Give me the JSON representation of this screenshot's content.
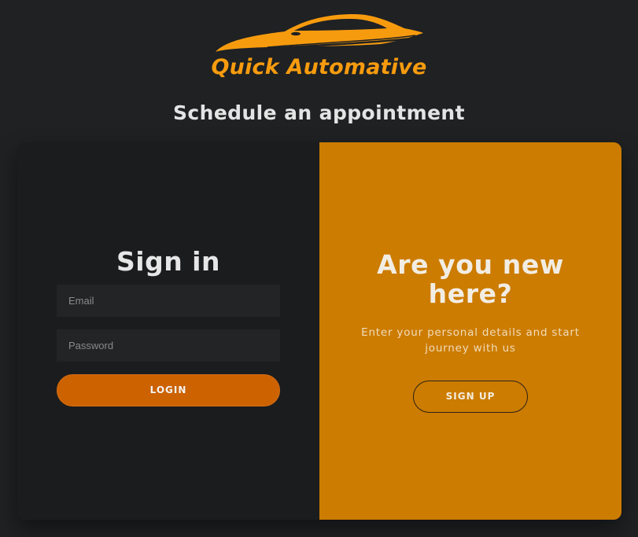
{
  "brand": {
    "name": "Quick Automative",
    "color": "#f79b0e",
    "logo_icon": "car-silhouette-icon"
  },
  "page": {
    "title": "Schedule an appointment"
  },
  "signin": {
    "title": "Sign in",
    "email_placeholder": "Email",
    "password_placeholder": "Password",
    "login_label": "LOGIN"
  },
  "signup_panel": {
    "title": "Are you new here?",
    "description": "Enter your personal details and start journey with us",
    "signup_label": "SIGN UP",
    "color": "#cc7c00"
  },
  "colors": {
    "background": "#1f2123",
    "left_panel": "#1b1c1e",
    "login_button": "#cc6200"
  }
}
